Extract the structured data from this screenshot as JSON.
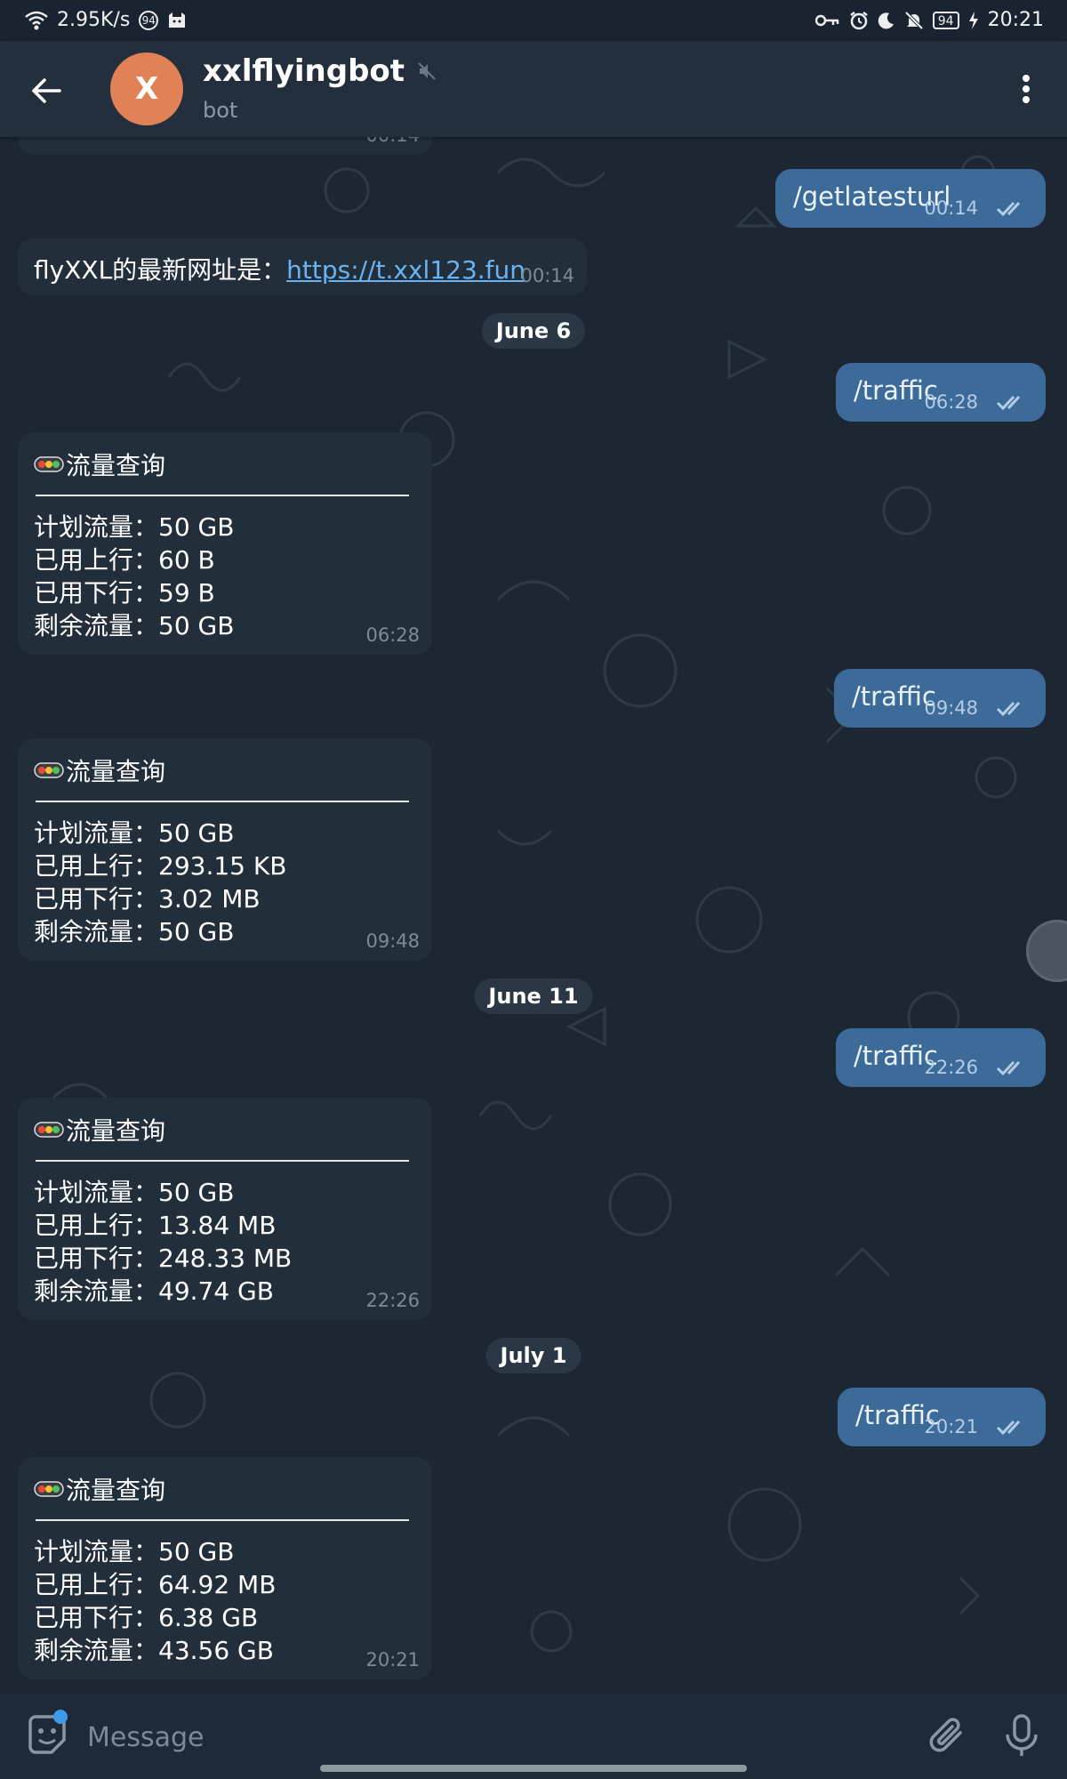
{
  "status_bar": {
    "net_speed": "2.95K/s",
    "notif_badge": "94",
    "battery": "94",
    "time": "20:21"
  },
  "header": {
    "avatar_letter": "X",
    "avatar_color": "#e08256",
    "title": "xxlflyingbot",
    "subtitle": "bot"
  },
  "messages": {
    "m0_time": "00:14",
    "m1_text": "/getlatesturl",
    "m1_time": "00:14",
    "m2_prefix": "flyXXL的最新网址是：",
    "m2_link": "https://t.xxl123.fun",
    "m2_time": "00:14",
    "d1": "June 6",
    "m3_text": "/traffic",
    "m3_time": "06:28",
    "m4_title": "流量查询",
    "m4_l1": "计划流量：50 GB",
    "m4_l2": "已用上行：60 B",
    "m4_l3": "已用下行：59 B",
    "m4_l4": "剩余流量：50 GB",
    "m4_time": "06:28",
    "m5_text": "/traffic",
    "m5_time": "09:48",
    "m6_title": "流量查询",
    "m6_l1": "计划流量：50 GB",
    "m6_l2": "已用上行：293.15 KB",
    "m6_l3": "已用下行：3.02 MB",
    "m6_l4": "剩余流量：50 GB",
    "m6_time": "09:48",
    "d2": "June 11",
    "m7_text": "/traffic",
    "m7_time": "22:26",
    "m8_title": "流量查询",
    "m8_l1": "计划流量：50 GB",
    "m8_l2": "已用上行：13.84 MB",
    "m8_l3": "已用下行：248.33 MB",
    "m8_l4": "剩余流量：49.74 GB",
    "m8_time": "22:26",
    "d3": "July 1",
    "m9_text": "/traffic",
    "m9_time": "20:21",
    "m10_title": "流量查询",
    "m10_l1": "计划流量：50 GB",
    "m10_l2": "已用上行：64.92 MB",
    "m10_l3": "已用下行：6.38 GB",
    "m10_l4": "剩余流量：43.56 GB",
    "m10_time": "20:21"
  },
  "input": {
    "placeholder": "Message"
  },
  "colors": {
    "background": "#1c2733",
    "header": "#242f3d",
    "incoming_bubble": "#232e3b",
    "outgoing_bubble": "#3d6b99",
    "link": "#6ab3f3"
  }
}
